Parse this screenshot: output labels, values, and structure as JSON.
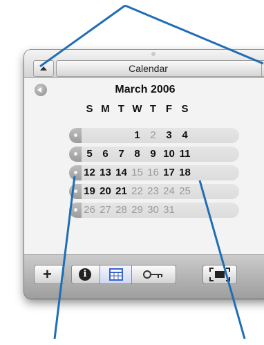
{
  "panel": {
    "title": "Calendar"
  },
  "calendar": {
    "month_title": "March 2006",
    "weekdays": [
      "S",
      "M",
      "T",
      "W",
      "T",
      "F",
      "S"
    ],
    "weeks": [
      {
        "days": [
          {
            "d": "",
            "bold": false
          },
          {
            "d": "",
            "bold": false
          },
          {
            "d": "",
            "bold": false
          },
          {
            "d": "1",
            "bold": true
          },
          {
            "d": "2",
            "bold": false
          },
          {
            "d": "3",
            "bold": true
          },
          {
            "d": "4",
            "bold": true
          }
        ]
      },
      {
        "days": [
          {
            "d": "5",
            "bold": true
          },
          {
            "d": "6",
            "bold": true
          },
          {
            "d": "7",
            "bold": true
          },
          {
            "d": "8",
            "bold": true
          },
          {
            "d": "9",
            "bold": true
          },
          {
            "d": "10",
            "bold": true
          },
          {
            "d": "11",
            "bold": true
          }
        ]
      },
      {
        "days": [
          {
            "d": "12",
            "bold": true
          },
          {
            "d": "13",
            "bold": true
          },
          {
            "d": "14",
            "bold": true
          },
          {
            "d": "15",
            "bold": false
          },
          {
            "d": "16",
            "bold": false
          },
          {
            "d": "17",
            "bold": true
          },
          {
            "d": "18",
            "bold": true
          }
        ]
      },
      {
        "days": [
          {
            "d": "19",
            "bold": true
          },
          {
            "d": "20",
            "bold": true
          },
          {
            "d": "21",
            "bold": true
          },
          {
            "d": "22",
            "bold": false
          },
          {
            "d": "23",
            "bold": false
          },
          {
            "d": "24",
            "bold": false
          },
          {
            "d": "25",
            "bold": false
          }
        ]
      },
      {
        "days": [
          {
            "d": "26",
            "bold": false
          },
          {
            "d": "27",
            "bold": false
          },
          {
            "d": "28",
            "bold": false
          },
          {
            "d": "29",
            "bold": false
          },
          {
            "d": "30",
            "bold": false
          },
          {
            "d": "31",
            "bold": false
          },
          {
            "d": "",
            "bold": false
          }
        ]
      }
    ]
  },
  "toolbar": {
    "buttons": [
      "add-icon",
      "info-icon",
      "calendar-view-icon",
      "key-icon",
      "fullscreen-icon"
    ]
  },
  "colors": {
    "callout_line": "#1f6db5",
    "panel_bg": "#e7e7e7",
    "week_row": "#dedede",
    "accent_blue": "#3b62c8"
  }
}
